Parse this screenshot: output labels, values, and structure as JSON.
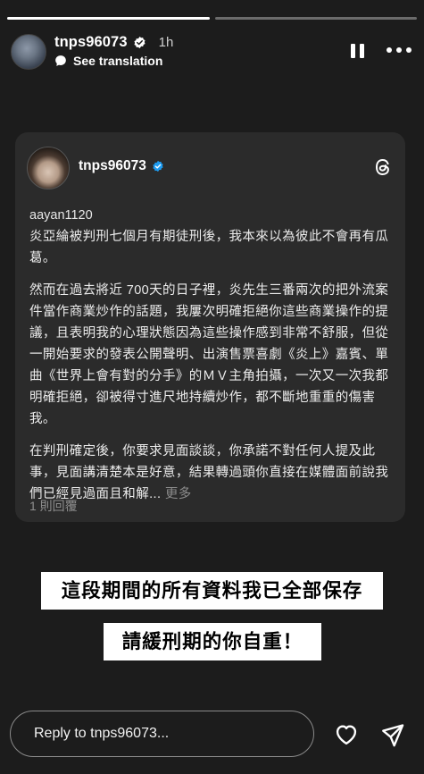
{
  "story": {
    "progress": [
      1.0,
      0.0
    ],
    "username": "tnps96073",
    "time": "1h",
    "see_translation": "See translation"
  },
  "post": {
    "username": "tnps96073",
    "reply_to": "aayan1120",
    "paragraphs": [
      "炎亞綸被判刑七個月有期徒刑後，我本來以為彼此不會再有瓜葛。",
      "然而在過去將近 700天的日子裡，炎先生三番兩次的把外流案件當作商業炒作的話題，我屢次明確拒絕你這些商業操作的提議，且表明我的心理狀態因為這些操作感到非常不舒服，但從一開始要求的發表公開聲明、出演售票喜劇《炎上》嘉賓、單曲《世界上會有對的分手》的ＭＶ主角拍攝，一次又一次我都明確拒絕，卻被得寸進尺地持續炒作，都不斷地重重的傷害我。",
      "在判刑確定後，你要求見面談談，你承諾不對任何人提及此事，見面講清楚本是好意，結果轉過頭你直接在媒體面前說我們已經見過面且和解..."
    ],
    "more_label": " 更多",
    "reply_count": "1 則回覆"
  },
  "captions": {
    "line1": "這段期間的所有資料我已全部保存",
    "line2": "請緩刑期的你自重！"
  },
  "footer": {
    "reply_placeholder": "Reply to tnps96073..."
  },
  "icons": {
    "verified_story": "verified-badge-icon",
    "verified_card": "verified-badge-icon",
    "threads": "threads-logo-icon",
    "translate": "chat-bubble-icon",
    "pause": "pause-icon",
    "more": "more-dots-icon",
    "heart": "heart-icon",
    "send": "send-icon"
  },
  "colors": {
    "background": "#1c1c1c",
    "card": "#2b2b2b",
    "verified_blue": "#1d9bf0"
  }
}
